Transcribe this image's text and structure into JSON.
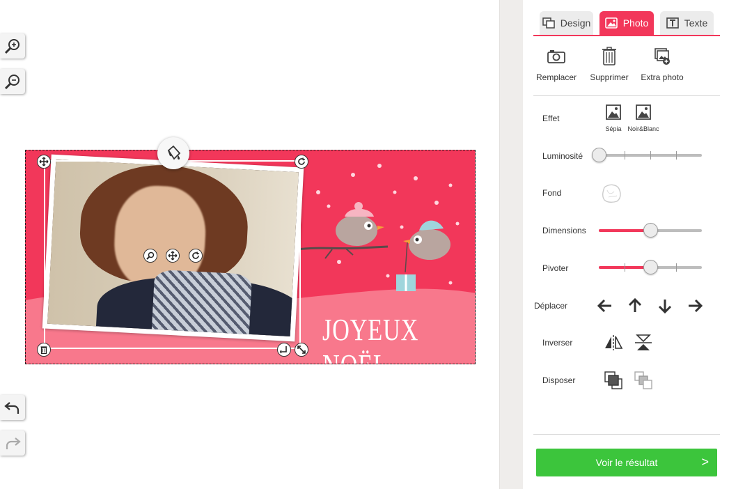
{
  "tabs": [
    {
      "label": "Design",
      "icon": "design-icon",
      "active": false
    },
    {
      "label": "Photo",
      "icon": "photo-icon",
      "active": true
    },
    {
      "label": "Texte",
      "icon": "text-icon",
      "active": false
    }
  ],
  "actions": [
    {
      "label": "Remplacer",
      "icon": "camera-icon"
    },
    {
      "label": "Supprimer",
      "icon": "trash-icon"
    },
    {
      "label": "Extra photo",
      "icon": "add-photo-icon"
    }
  ],
  "settings": {
    "effet_label": "Effet",
    "effects": [
      "Sépia",
      "Noir&Blanc"
    ],
    "luminosite_label": "Luminosité",
    "luminosite_value": 0.0,
    "fond_label": "Fond",
    "dimensions_label": "Dimensions",
    "dimensions_value": 0.5,
    "pivoter_label": "Pivoter",
    "pivoter_value": 0.5,
    "deplacer_label": "Déplacer",
    "inverser_label": "Inverser",
    "disposer_label": "Disposer"
  },
  "card": {
    "title": "JOYEUX NOËL",
    "background_color": "#f2375a",
    "wave_color": "#f8788c"
  },
  "result_button": {
    "label": "Voir le résultat",
    "chevron": ">"
  },
  "colors": {
    "accent": "#f2375a",
    "success": "#3cc53c"
  }
}
